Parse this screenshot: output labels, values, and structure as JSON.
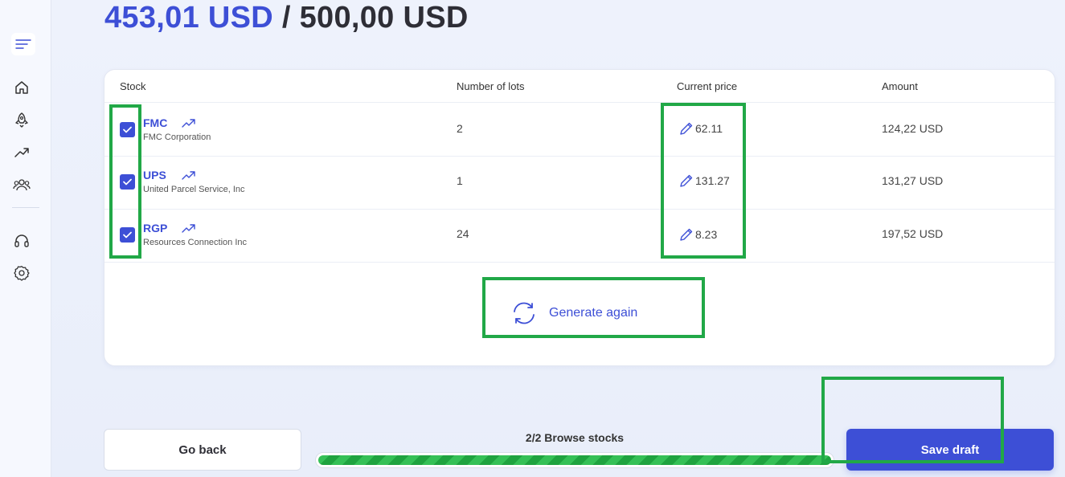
{
  "budget": {
    "spent": "453,01 USD",
    "separator": "/",
    "total": "500,00 USD"
  },
  "sidebar": {
    "items": [
      {
        "icon": "menu-icon"
      },
      {
        "icon": "home-icon"
      },
      {
        "icon": "rocket-icon"
      },
      {
        "icon": "trending-up-icon"
      },
      {
        "icon": "users-icon"
      },
      {
        "icon": "headset-icon"
      },
      {
        "icon": "settings-icon"
      }
    ]
  },
  "table": {
    "headers": {
      "stock": "Stock",
      "lots": "Number of lots",
      "price": "Current price",
      "amount": "Amount"
    },
    "rows": [
      {
        "ticker": "FMC",
        "company": "FMC Corporation",
        "lots": "2",
        "price": "62.11",
        "amount": "124,22 USD",
        "checked": true
      },
      {
        "ticker": "UPS",
        "company": "United Parcel Service, Inc",
        "lots": "1",
        "price": "131.27",
        "amount": "131,27 USD",
        "checked": true
      },
      {
        "ticker": "RGP",
        "company": "Resources Connection Inc",
        "lots": "24",
        "price": "8.23",
        "amount": "197,52 USD",
        "checked": true
      }
    ]
  },
  "generate": {
    "label": "Generate again"
  },
  "footer": {
    "back_label": "Go back",
    "progress_label": "2/2 Browse stocks",
    "progress_value": 1.0,
    "save_label": "Save draft"
  },
  "colors": {
    "accent": "#3d4fd6",
    "progress": "#1fa33f",
    "highlight": "#21a847"
  }
}
